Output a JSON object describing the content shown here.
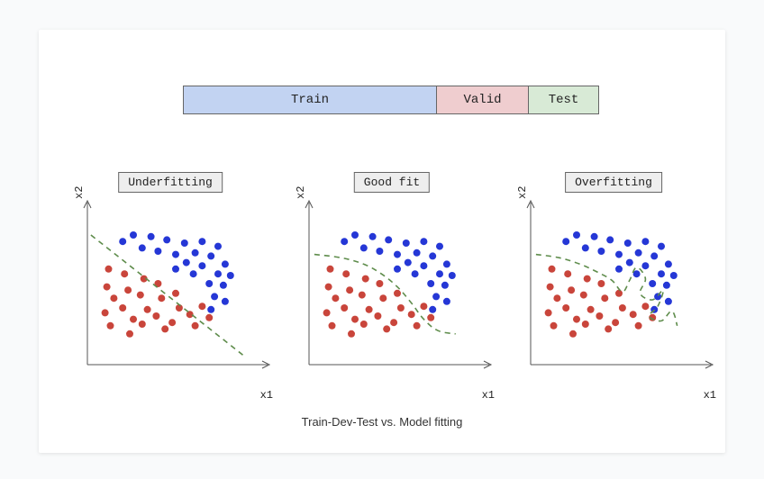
{
  "split_bar": {
    "train_label": "Train",
    "valid_label": "Valid",
    "test_label": "Test"
  },
  "plots": [
    {
      "title": "Underfitting",
      "xlabel": "x1",
      "ylabel": "x2"
    },
    {
      "title": "Good fit",
      "xlabel": "x1",
      "ylabel": "x2"
    },
    {
      "title": "Overfitting",
      "xlabel": "x1",
      "ylabel": "x2"
    }
  ],
  "caption": "Train-Dev-Test vs. Model fitting",
  "chart_data": {
    "type": "scatter",
    "description": "Three panels showing the same 2D point cloud of two classes (red and blue) with different decision boundaries illustrating underfitting, good fit, and overfitting.",
    "colors": {
      "class_a": "#c9453b",
      "class_b": "#2537d6",
      "boundary": "#5e8c4b"
    },
    "xlim": [
      0,
      10
    ],
    "ylim": [
      0,
      10
    ],
    "shared_points": {
      "class_a": [
        [
          1.2,
          5.9
        ],
        [
          1.1,
          4.8
        ],
        [
          1.5,
          4.1
        ],
        [
          1.0,
          3.2
        ],
        [
          1.3,
          2.4
        ],
        [
          2.1,
          5.6
        ],
        [
          2.3,
          4.6
        ],
        [
          2.0,
          3.5
        ],
        [
          2.6,
          2.8
        ],
        [
          2.4,
          1.9
        ],
        [
          3.2,
          5.3
        ],
        [
          3.0,
          4.3
        ],
        [
          3.4,
          3.4
        ],
        [
          3.1,
          2.5
        ],
        [
          4.0,
          5.0
        ],
        [
          4.2,
          4.1
        ],
        [
          3.9,
          3.0
        ],
        [
          4.4,
          2.2
        ],
        [
          5.0,
          4.4
        ],
        [
          5.2,
          3.5
        ],
        [
          4.8,
          2.6
        ],
        [
          5.8,
          3.1
        ],
        [
          6.1,
          2.4
        ],
        [
          6.5,
          3.6
        ],
        [
          6.9,
          2.9
        ]
      ],
      "class_b": [
        [
          2.0,
          7.6
        ],
        [
          2.6,
          8.0
        ],
        [
          3.1,
          7.2
        ],
        [
          3.6,
          7.9
        ],
        [
          4.0,
          7.0
        ],
        [
          4.5,
          7.7
        ],
        [
          5.0,
          6.8
        ],
        [
          5.5,
          7.5
        ],
        [
          5.0,
          5.9
        ],
        [
          5.6,
          6.3
        ],
        [
          6.1,
          6.9
        ],
        [
          6.5,
          7.6
        ],
        [
          6.0,
          5.6
        ],
        [
          6.5,
          6.1
        ],
        [
          7.0,
          6.7
        ],
        [
          7.4,
          7.3
        ],
        [
          6.9,
          5.0
        ],
        [
          7.4,
          5.6
        ],
        [
          7.8,
          6.2
        ],
        [
          7.2,
          4.2
        ],
        [
          7.7,
          4.9
        ],
        [
          8.1,
          5.5
        ],
        [
          7.0,
          3.4
        ],
        [
          7.8,
          3.9
        ]
      ]
    },
    "panels": [
      {
        "name": "Underfitting",
        "boundary_type": "line",
        "boundary": [
          [
            0.2,
            8.0
          ],
          [
            8.8,
            0.6
          ]
        ]
      },
      {
        "name": "Good fit",
        "boundary_type": "curve",
        "boundary": [
          [
            0.3,
            6.8
          ],
          [
            1.8,
            6.6
          ],
          [
            3.1,
            6.2
          ],
          [
            4.1,
            5.6
          ],
          [
            5.0,
            4.8
          ],
          [
            5.8,
            3.8
          ],
          [
            6.5,
            2.8
          ],
          [
            7.3,
            2.1
          ],
          [
            8.3,
            1.9
          ]
        ]
      },
      {
        "name": "Overfitting",
        "boundary_type": "curve",
        "boundary": [
          [
            0.3,
            6.8
          ],
          [
            1.6,
            6.6
          ],
          [
            2.8,
            6.2
          ],
          [
            3.8,
            5.7
          ],
          [
            4.6,
            5.2
          ],
          [
            5.2,
            4.5
          ],
          [
            5.6,
            5.2
          ],
          [
            6.0,
            6.0
          ],
          [
            6.5,
            5.3
          ],
          [
            6.2,
            4.4
          ],
          [
            6.9,
            4.0
          ],
          [
            7.5,
            4.6
          ],
          [
            7.2,
            3.6
          ],
          [
            6.7,
            3.0
          ],
          [
            7.4,
            2.7
          ],
          [
            8.0,
            3.3
          ],
          [
            8.3,
            2.4
          ]
        ]
      }
    ]
  }
}
